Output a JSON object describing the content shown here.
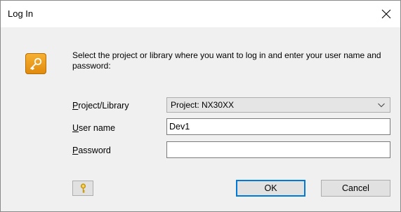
{
  "window": {
    "title": "Log In",
    "close_icon": "close-icon"
  },
  "dialog": {
    "icon": "key-icon",
    "instructions": "Select the project or library where you want to log in and enter your user name and password:"
  },
  "fields": {
    "project_library": {
      "label_mnemonic": "P",
      "label_rest": "roject/Library",
      "value": "Project: NX30XX"
    },
    "user_name": {
      "label_mnemonic": "U",
      "label_rest": "ser name",
      "value": "Dev1"
    },
    "password": {
      "label_mnemonic": "P",
      "label_rest": "assword",
      "value": ""
    }
  },
  "buttons": {
    "key_icon": "key-icon",
    "ok": "OK",
    "cancel": "Cancel"
  },
  "colors": {
    "accent": "#0078d7",
    "icon_orange": "#f0a020"
  }
}
